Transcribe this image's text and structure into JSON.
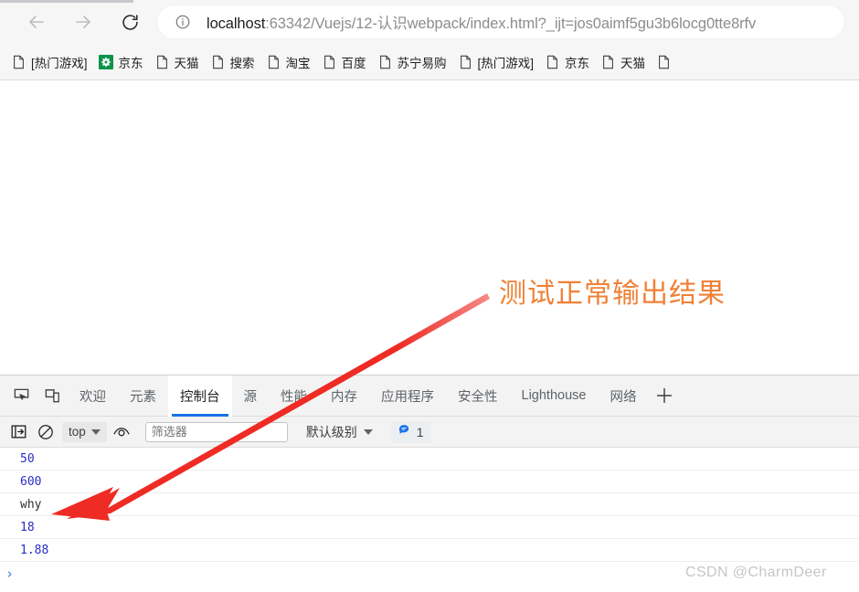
{
  "browser": {
    "nav": {
      "back_title": "后退",
      "forward_title": "前进",
      "reload_title": "重新加载"
    },
    "omnibox": {
      "info_icon": "info-circle-icon",
      "url_host": "localhost",
      "url_rest": ":63342/Vuejs/12-认识webpack/index.html?_ijt=jos0aimf5gu3b6locg0tte8rfv",
      "url_full": "localhost:63342/Vuejs/12-认识webpack/index.html?_ijt=jos0aimf5gu3b6locg0tte8rfv"
    },
    "bookmarks": [
      {
        "label": "[热门游戏]",
        "icon": "page-icon"
      },
      {
        "label": "京东",
        "icon": "jd-logo-icon"
      },
      {
        "label": "天猫",
        "icon": "page-icon"
      },
      {
        "label": "搜索",
        "icon": "page-icon"
      },
      {
        "label": "淘宝",
        "icon": "page-icon"
      },
      {
        "label": "百度",
        "icon": "page-icon"
      },
      {
        "label": "苏宁易购",
        "icon": "page-icon"
      },
      {
        "label": "[热门游戏]",
        "icon": "page-icon"
      },
      {
        "label": "京东",
        "icon": "page-icon"
      },
      {
        "label": "天猫",
        "icon": "page-icon"
      },
      {
        "label": "",
        "icon": "page-icon"
      }
    ]
  },
  "annotation": {
    "text": "测试正常输出结果",
    "color": "#ef8136",
    "arrow_color": "#ee2b24"
  },
  "devtools": {
    "left_icons": [
      {
        "name": "inspect-element-icon"
      },
      {
        "name": "device-toolbar-icon"
      }
    ],
    "tabs": [
      {
        "label": "欢迎",
        "active": false
      },
      {
        "label": "元素",
        "active": false
      },
      {
        "label": "控制台",
        "active": true
      },
      {
        "label": "源",
        "active": false
      },
      {
        "label": "性能",
        "active": false
      },
      {
        "label": "内存",
        "active": false
      },
      {
        "label": "应用程序",
        "active": false
      },
      {
        "label": "安全性",
        "active": false
      },
      {
        "label": "Lighthouse",
        "active": false
      },
      {
        "label": "网络",
        "active": false
      }
    ],
    "add_tab_label": "+",
    "console_toolbar": {
      "sidebar_toggle_icon": "console-sidebar-icon",
      "clear_icon": "clear-console-icon",
      "context_selected": "top",
      "live_expression_icon": "eye-icon",
      "filter_placeholder": "筛选器",
      "filter_value": "",
      "level_label": "默认级别",
      "message_count": "1",
      "message_icon": "speech-bubble-icon"
    },
    "console_logs": [
      {
        "value": "50",
        "kind": "num"
      },
      {
        "value": "600",
        "kind": "num"
      },
      {
        "value": "why",
        "kind": "str"
      },
      {
        "value": "18",
        "kind": "num"
      },
      {
        "value": "1.88",
        "kind": "num"
      }
    ],
    "prompt_caret": "›"
  },
  "watermark": {
    "text": "CSDN @CharmDeer"
  }
}
